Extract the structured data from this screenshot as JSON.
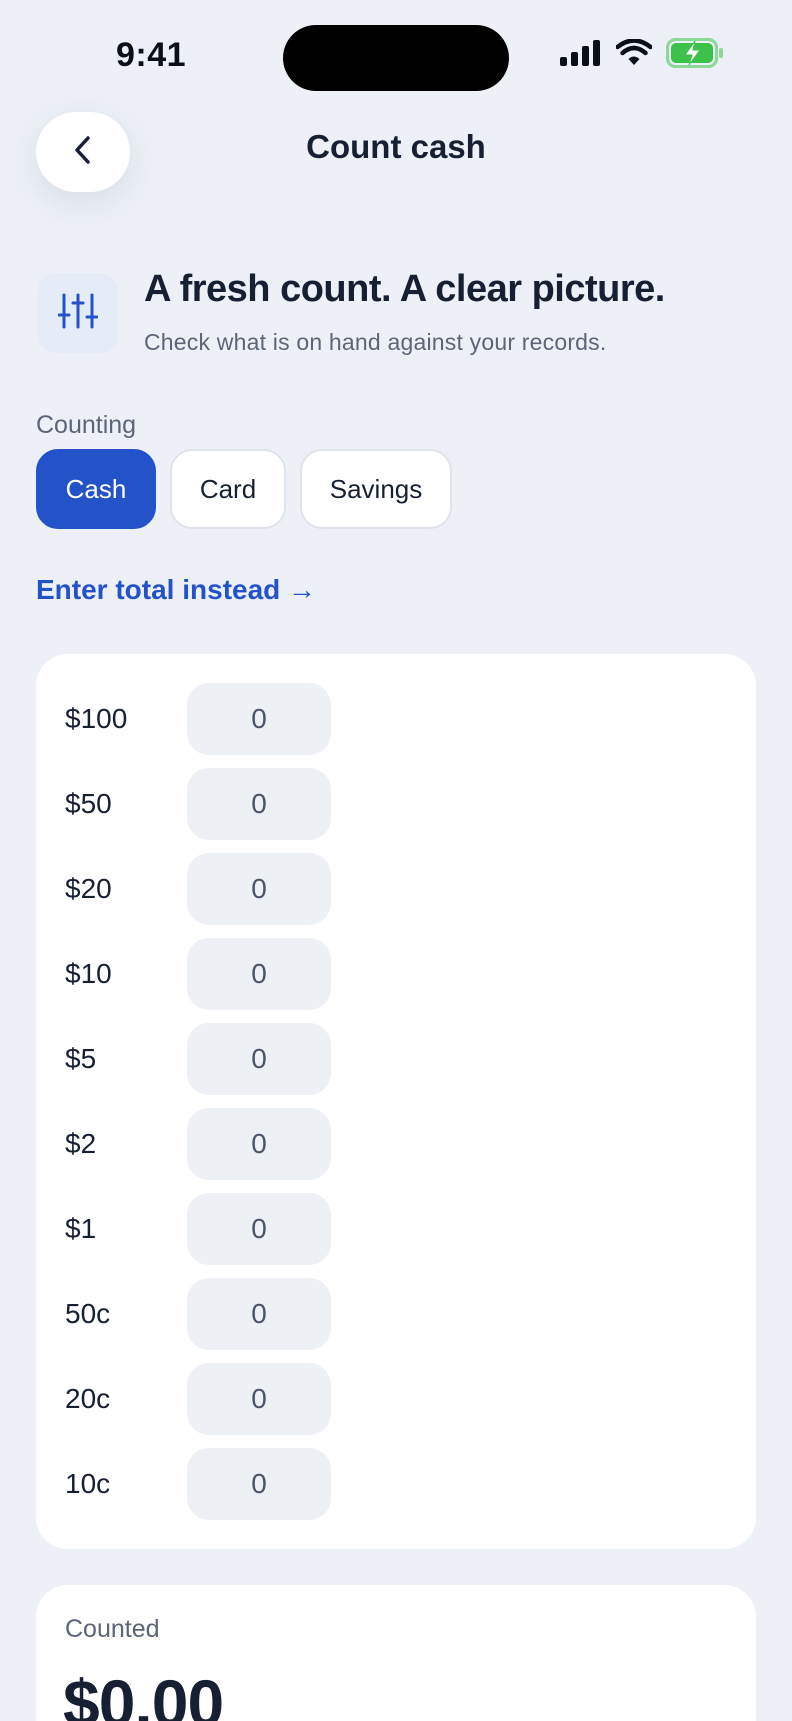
{
  "status_bar": {
    "time": "9:41",
    "icons": [
      "signal-icon",
      "wifi-icon",
      "battery-charging-icon"
    ],
    "battery_color": "#3cc24a"
  },
  "header": {
    "back_icon": "chevron-left-icon",
    "title": "Count cash"
  },
  "hero": {
    "icon": "sliders-icon",
    "title": "A fresh count. A clear picture.",
    "subtitle": "Check what is on hand against your records."
  },
  "counting": {
    "label": "Counting",
    "options": [
      {
        "label": "Cash",
        "selected": true
      },
      {
        "label": "Card",
        "selected": false
      },
      {
        "label": "Savings",
        "selected": false
      }
    ]
  },
  "enter_total_link": "Enter total instead →",
  "denominations": [
    {
      "label": "$100",
      "value": "0"
    },
    {
      "label": "$50",
      "value": "0"
    },
    {
      "label": "$20",
      "value": "0"
    },
    {
      "label": "$10",
      "value": "0"
    },
    {
      "label": "$5",
      "value": "0"
    },
    {
      "label": "$2",
      "value": "0"
    },
    {
      "label": "$1",
      "value": "0"
    },
    {
      "label": "50c",
      "value": "0"
    },
    {
      "label": "20c",
      "value": "0"
    },
    {
      "label": "10c",
      "value": "0"
    }
  ],
  "summary": {
    "label": "Counted",
    "value": "$0.00"
  },
  "colors": {
    "accent": "#2452c9",
    "background": "#edf1f7",
    "text": "#172033"
  }
}
